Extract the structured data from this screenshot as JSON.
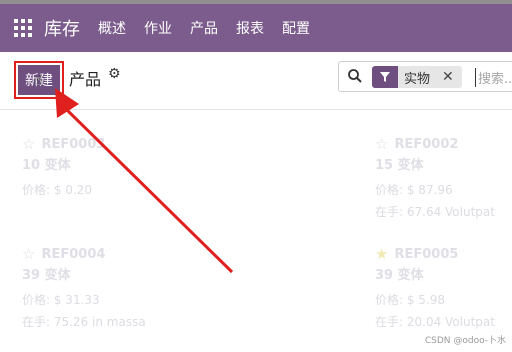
{
  "topbar": {
    "app_title": "库存",
    "menu": [
      "概述",
      "作业",
      "产品",
      "报表",
      "配置"
    ]
  },
  "control": {
    "new_button_label": "新建",
    "breadcrumb": "产品",
    "search": {
      "facet_label": "实物",
      "placeholder": "搜索..."
    }
  },
  "products": [
    {
      "ref": "REF0003",
      "variants": "10 变体",
      "price": "价格: $ 0.20",
      "stock": "",
      "favorite": false
    },
    {
      "ref": "REF0002",
      "variants": "15 变体",
      "price": "价格: $ 87.96",
      "stock": "在手: 67.64 Volutpat",
      "favorite": false
    },
    {
      "ref": "REF0004",
      "variants": "39 变体",
      "price": "价格: $ 31.33",
      "stock": "在手: 75.26 in massa",
      "favorite": false
    },
    {
      "ref": "REF0005",
      "variants": "39 变体",
      "price": "价格: $ 5.98",
      "stock": "在手: 20.04 Volutpat",
      "favorite": true
    }
  ],
  "watermark": "CSDN @odoo-卜水",
  "colors": {
    "brand_purple": "#7b5c8c",
    "button_purple": "#6e4f80",
    "annotation_red": "#e0201f"
  }
}
